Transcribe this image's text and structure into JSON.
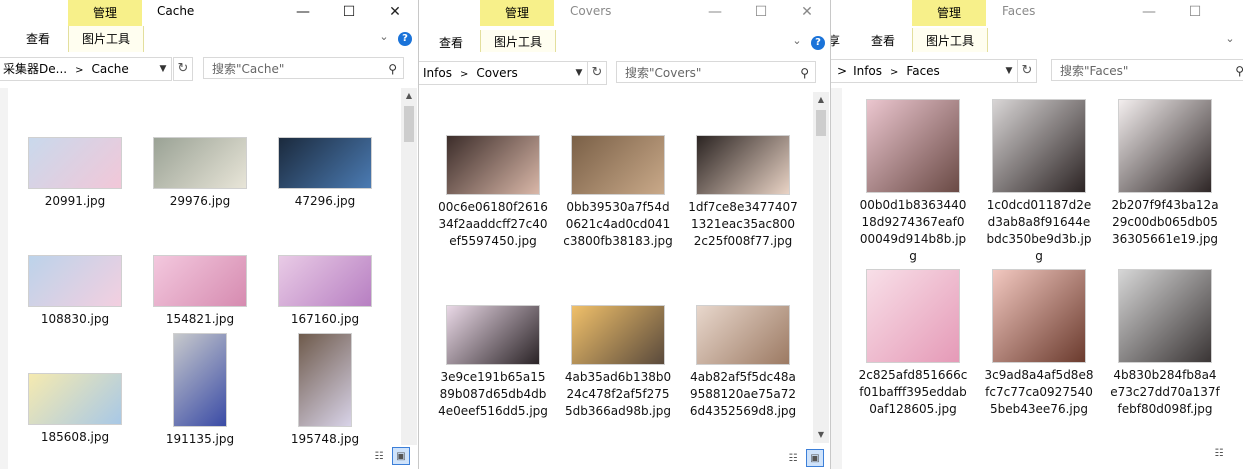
{
  "windows": [
    {
      "id": "cache",
      "manage_label": "管理",
      "title": "Cache",
      "view_tab": "查看",
      "picture_tools_tab": "图片工具",
      "address": {
        "parent": "采集器De...",
        "current": "Cache"
      },
      "search_placeholder": "搜索\"Cache\"",
      "files": [
        {
          "name": "20991.jpg",
          "colors": [
            "#c9d9ec",
            "#f2c7d8"
          ]
        },
        {
          "name": "29976.jpg",
          "colors": [
            "#9aa295",
            "#e8e5d8"
          ]
        },
        {
          "name": "47296.jpg",
          "colors": [
            "#1b2a3d",
            "#4b7bb3"
          ]
        },
        {
          "name": "108830.jpg",
          "colors": [
            "#bcd3ea",
            "#f3cfe0"
          ]
        },
        {
          "name": "154821.jpg",
          "colors": [
            "#f3c8de",
            "#d68bb0"
          ]
        },
        {
          "name": "167160.jpg",
          "colors": [
            "#e9cbe6",
            "#b77fc2"
          ]
        },
        {
          "name": "185608.jpg",
          "colors": [
            "#f5eab0",
            "#a8c8e6"
          ]
        },
        {
          "name": "191135.jpg",
          "colors": [
            "#c7c9cc",
            "#3a4ba6"
          ]
        },
        {
          "name": "195748.jpg",
          "colors": [
            "#6e5a4b",
            "#d8d3e8"
          ]
        }
      ]
    },
    {
      "id": "covers",
      "manage_label": "管理",
      "title": "Covers",
      "view_tab": "查看",
      "picture_tools_tab": "图片工具",
      "address": {
        "parent": "Infos",
        "current": "Covers"
      },
      "search_placeholder": "搜索\"Covers\"",
      "files": [
        {
          "name": "00c6e06180f261634f2aaddcff27c40ef5597450.jpg",
          "colors": [
            "#3c2d2a",
            "#d9b7a8"
          ]
        },
        {
          "name": "0bb39530a7f54d0621c4ad0cd041c3800fb38183.jpg",
          "colors": [
            "#7a6047",
            "#c9a989"
          ]
        },
        {
          "name": "1df7ce8e34774071321eac35ac8002c25f008f77.jpg",
          "colors": [
            "#2b2422",
            "#e9d3c5"
          ]
        },
        {
          "name": "3e9ce191b65a1589b087d65db4db4e0eef516dd5.jpg",
          "colors": [
            "#e9d8e6",
            "#2a2326"
          ]
        },
        {
          "name": "4ab35ad6b138b024c478f2af5f2755db366ad98b.jpg",
          "colors": [
            "#f0c06a",
            "#5a4a3c"
          ]
        },
        {
          "name": "4ab82af5f5dc48a9588120ae75a726d4352569d8.jpg",
          "colors": [
            "#e8d7cc",
            "#9c7a63"
          ]
        }
      ]
    },
    {
      "id": "faces",
      "manage_label": "管理",
      "title": "Faces",
      "view_tab": "查看",
      "partial_tab": "享",
      "picture_tools_tab": "图片工具",
      "address": {
        "parent": "Infos",
        "current": "Faces"
      },
      "search_placeholder": "搜索\"Faces\"",
      "files": [
        {
          "name": "00b0d1b836344018d9274367eaf000049d914b8b.jpg",
          "colors": [
            "#ebc6cf",
            "#6a4a45"
          ]
        },
        {
          "name": "1c0dcd01187d2ed3ab8a8f91644ebdc350be9d3b.jpg",
          "colors": [
            "#d8d5d5",
            "#2c2424"
          ]
        },
        {
          "name": "2b207f9f43ba12a29c00db065db0536305661e19.jpg",
          "colors": [
            "#f3eeee",
            "#2e2626"
          ]
        },
        {
          "name": "2c825afd851666cf01bafff395eddab0af128605.jpg",
          "colors": [
            "#f8dfe8",
            "#e59ab7"
          ]
        },
        {
          "name": "3c9ad8a4af5d8e8fc7c77ca09275405beb43ee76.jpg",
          "colors": [
            "#f2c8c0",
            "#6b3b2e"
          ]
        },
        {
          "name": "4b830b284fb8a4e73c27dd70a137ffebf80d098f.jpg",
          "colors": [
            "#d6d6d6",
            "#3a3535"
          ]
        }
      ]
    }
  ]
}
